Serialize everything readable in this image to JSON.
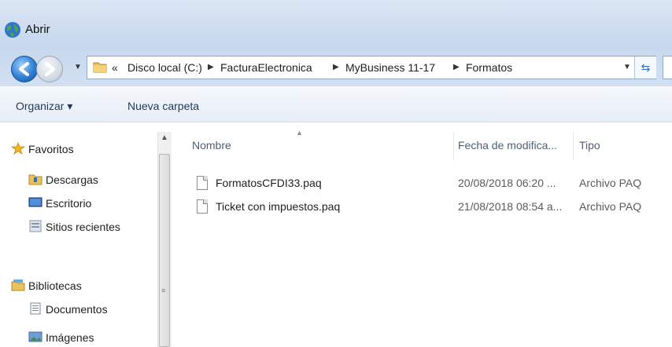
{
  "window": {
    "title": "Abrir"
  },
  "address": {
    "overflow": "«",
    "crumbs": [
      "Disco local (C:)",
      "FacturaElectronica",
      "MyBusiness 11-17",
      "Formatos"
    ]
  },
  "toolbar": {
    "organize": "Organizar ▾",
    "new_folder": "Nueva carpeta"
  },
  "nav": {
    "favorites": "Favoritos",
    "downloads": "Descargas",
    "desktop": "Escritorio",
    "recent": "Sitios recientes",
    "libraries": "Bibliotecas",
    "documents": "Documentos",
    "images": "Imágenes"
  },
  "columns": {
    "name": "Nombre",
    "date": "Fecha de modifica...",
    "type": "Tipo"
  },
  "files": [
    {
      "name": "FormatosCFDI33.paq",
      "date": "20/08/2018 06:20 ...",
      "type": "Archivo PAQ"
    },
    {
      "name": "Ticket con impuestos.paq",
      "date": "21/08/2018 08:54 a...",
      "type": "Archivo PAQ"
    }
  ]
}
